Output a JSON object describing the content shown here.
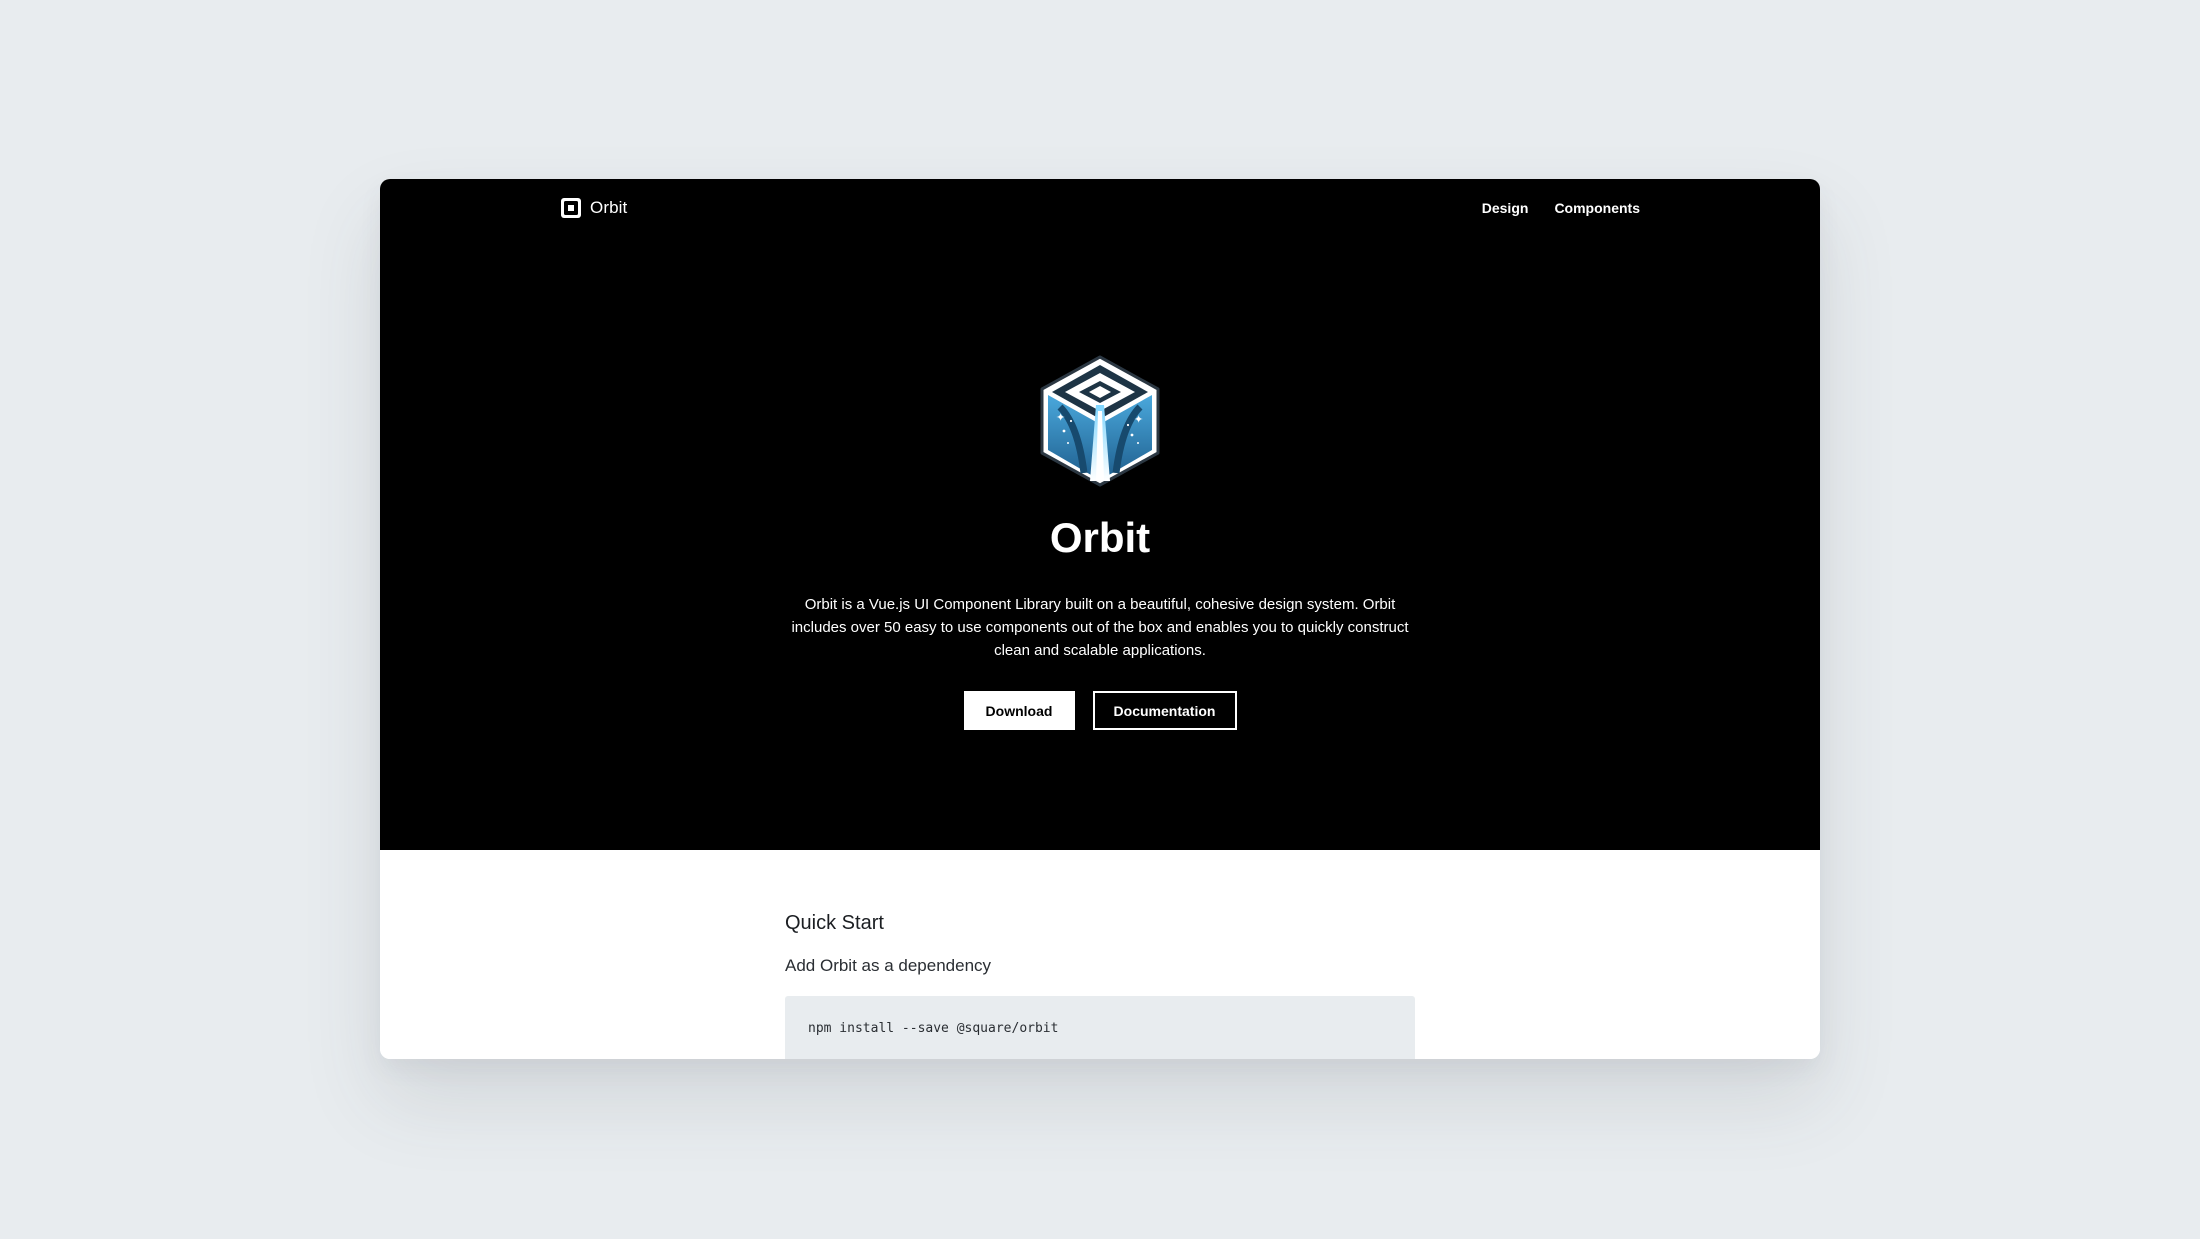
{
  "nav": {
    "brand": "Orbit",
    "links": [
      {
        "label": "Design"
      },
      {
        "label": "Components"
      }
    ]
  },
  "hero": {
    "logo_icon": "orbit-hexagon-logo-icon",
    "title": "Orbit",
    "description": "Orbit is a Vue.js UI Component Library built on a beautiful, cohesive design system. Orbit includes over 50 easy to use components out of the box and enables you to quickly construct clean and scalable applications.",
    "download_label": "Download",
    "documentation_label": "Documentation"
  },
  "quick_start": {
    "title": "Quick Start",
    "subtitle": "Add Orbit as a dependency",
    "command": "npm install --save @square/orbit"
  },
  "colors": {
    "background": "#e8ecef",
    "hero": "#000000",
    "content": "#ffffff",
    "code_background": "#e8ecef",
    "logo_blue": "#2f86c0",
    "logo_dark": "#103247"
  }
}
